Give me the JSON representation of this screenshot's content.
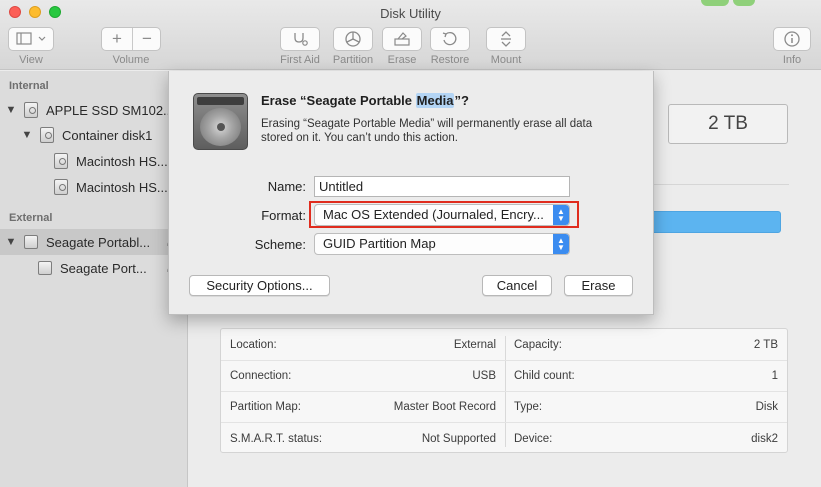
{
  "window": {
    "title": "Disk Utility"
  },
  "toolbar": {
    "view_label": "View",
    "volume_label": "Volume",
    "volume_add": "+",
    "volume_remove": "−",
    "first_aid_label": "First Aid",
    "partition_label": "Partition",
    "erase_label": "Erase",
    "restore_label": "Restore",
    "mount_label": "Mount",
    "info_label": "Info",
    "icons": [
      "sidebar-view-icon",
      "chevron-down-icon",
      "stethoscope-icon",
      "pie-partition-icon",
      "erase-disk-icon",
      "restore-arrow-icon",
      "mount-icon",
      "info-icon"
    ]
  },
  "sidebar": {
    "internal_header": "Internal",
    "external_header": "External",
    "internal_items": [
      {
        "label": "APPLE SSD SM102...",
        "disclosure": "▼"
      },
      {
        "label": "Container disk1",
        "disclosure": "▼"
      },
      {
        "label": "Macintosh HS..."
      },
      {
        "label": "Macintosh HS..."
      }
    ],
    "external_items": [
      {
        "label": "Seagate Portabl...",
        "disclosure": "▼",
        "eject": "⏏"
      },
      {
        "label": "Seagate Port...",
        "eject": "⏏"
      }
    ]
  },
  "main": {
    "capacity_display": "2 TB",
    "info": {
      "left": [
        {
          "label": "Location:",
          "value": "External"
        },
        {
          "label": "Connection:",
          "value": "USB"
        },
        {
          "label": "Partition Map:",
          "value": "Master Boot Record"
        },
        {
          "label": "S.M.A.R.T. status:",
          "value": "Not Supported"
        }
      ],
      "right": [
        {
          "label": "Capacity:",
          "value": "2 TB"
        },
        {
          "label": "Child count:",
          "value": "1"
        },
        {
          "label": "Type:",
          "value": "Disk"
        },
        {
          "label": "Device:",
          "value": "disk2"
        }
      ]
    }
  },
  "dialog": {
    "title_prefix": "Erase “Seagate Portable ",
    "title_highlight": "Media",
    "title_suffix": "”?",
    "description": "Erasing “Seagate Portable Media” will permanently erase all data stored on it. You can’t undo this action.",
    "name_label": "Name:",
    "name_value": "Untitled",
    "format_label": "Format:",
    "format_value": "Mac OS Extended (Journaled, Encry...",
    "scheme_label": "Scheme:",
    "scheme_value": "GUID Partition Map",
    "security_button": "Security Options...",
    "cancel_button": "Cancel",
    "erase_button": "Erase"
  },
  "colors": {
    "accent": "#3b8cf0",
    "highlight_border": "#e02c1e",
    "usage_bar": "#5cb4f0"
  }
}
